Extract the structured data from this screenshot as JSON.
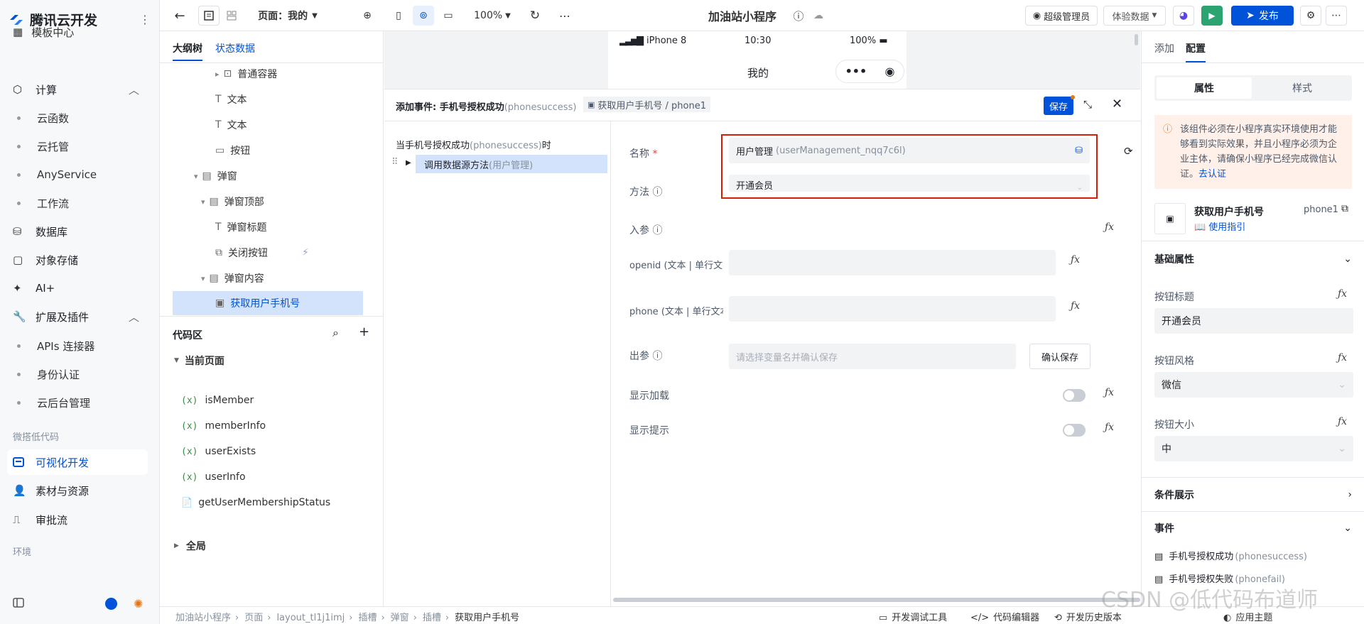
{
  "left_nav": {
    "brand": "腾讯云开发",
    "top_partial": "模板中心",
    "items": [
      {
        "label": "计算",
        "type": "group"
      },
      {
        "label": "云函数",
        "type": "sub"
      },
      {
        "label": "云托管",
        "type": "sub"
      },
      {
        "label": "AnyService",
        "type": "sub"
      },
      {
        "label": "工作流",
        "type": "sub"
      },
      {
        "label": "数据库",
        "type": "item"
      },
      {
        "label": "对象存储",
        "type": "item"
      },
      {
        "label": "AI+",
        "type": "item"
      },
      {
        "label": "扩展及插件",
        "type": "group"
      },
      {
        "label": "APIs 连接器",
        "type": "sub"
      },
      {
        "label": "身份认证",
        "type": "sub"
      },
      {
        "label": "云后台管理",
        "type": "sub"
      }
    ],
    "caption_lowcode": "微搭低代码",
    "lowcode_items": [
      {
        "label": "可视化开发"
      },
      {
        "label": "素材与资源"
      },
      {
        "label": "审批流"
      }
    ],
    "caption_env": "环境"
  },
  "topbar": {
    "page_label": "页面：我的",
    "zoom": "100%",
    "app_title": "加油站小程序",
    "role": "超级管理员",
    "data_mode": "体验数据",
    "publish": "发布"
  },
  "outline": {
    "tabs": [
      "大纲树",
      "状态数据"
    ],
    "tree": [
      {
        "label": "普通容器",
        "indent": 3
      },
      {
        "label": "文本",
        "indent": 3
      },
      {
        "label": "文本",
        "indent": 3
      },
      {
        "label": "按钮",
        "indent": 3
      },
      {
        "label": "弹窗",
        "indent": 1
      },
      {
        "label": "弹窗顶部",
        "indent": 2
      },
      {
        "label": "弹窗标题",
        "indent": 3
      },
      {
        "label": "关闭按钮",
        "indent": 3
      },
      {
        "label": "弹窗内容",
        "indent": 2
      },
      {
        "label": "获取用户手机号",
        "indent": 3
      }
    ],
    "code_title": "代码区",
    "current_page": "当前页面",
    "code_items": [
      "isMember",
      "memberInfo",
      "userExists",
      "userInfo",
      "getUserMembershipStatus"
    ],
    "global": "全局"
  },
  "phone": {
    "carrier": "iPhone 8",
    "time": "10:30",
    "battery": "100%",
    "title": "我的"
  },
  "event_panel": {
    "header_prefix": "添加事件: 手机号授权成功",
    "header_event": "(phonesuccess)",
    "component": "获取用户手机号 / phone1",
    "save": "保存",
    "trigger": "当手机号授权成功",
    "trigger_event": "(phonesuccess)",
    "trigger_suffix": "时",
    "action": "调用数据源方法",
    "action_src": "(用户管理)",
    "name_label": "名称",
    "name_value": "用户管理",
    "name_id": "(userManagement_nqq7c6l)",
    "method_label": "方法",
    "method_value": "开通会员",
    "params_label": "入参",
    "param1_label": "openid (文本 | 单行文本",
    "param2_label": "phone (文本 | 单行文本",
    "out_label": "出参",
    "out_placeholder": "请选择变量名并确认保存",
    "confirm_save": "确认保存",
    "show_loading": "显示加载",
    "show_tip": "显示提示"
  },
  "right_panel": {
    "tabs": [
      "添加",
      "配置"
    ],
    "seg": [
      "属性",
      "样式"
    ],
    "notice": "该组件必须在小程序真实环境使用才能够看到实际效果，并且小程序必须为企业主体，请确保小程序已经完成微信认证。",
    "notice_link": "去认证",
    "component_name": "获取用户手机号",
    "component_id": "phone1",
    "guide": "使用指引",
    "basic": "基础属性",
    "btn_title_label": "按钮标题",
    "btn_title_value": "开通会员",
    "btn_style_label": "按钮风格",
    "btn_style_value": "微信",
    "btn_size_label": "按钮大小",
    "btn_size_value": "中",
    "cond": "条件展示",
    "events": "事件",
    "event1": "手机号授权成功",
    "event1_id": "(phonesuccess)",
    "event2": "手机号授权失败",
    "event2_id": "(phonefail)"
  },
  "statusbar": {
    "crumbs": [
      "加油站小程序",
      "页面",
      "layout_tl1j1imj",
      "插槽",
      "弹窗",
      "插槽",
      "获取用户手机号"
    ],
    "debug": "开发调试工具",
    "code_editor": "代码编辑器",
    "history": "开发历史版本",
    "theme": "应用主题",
    "watermark": "CSDN @低代码布道师"
  }
}
